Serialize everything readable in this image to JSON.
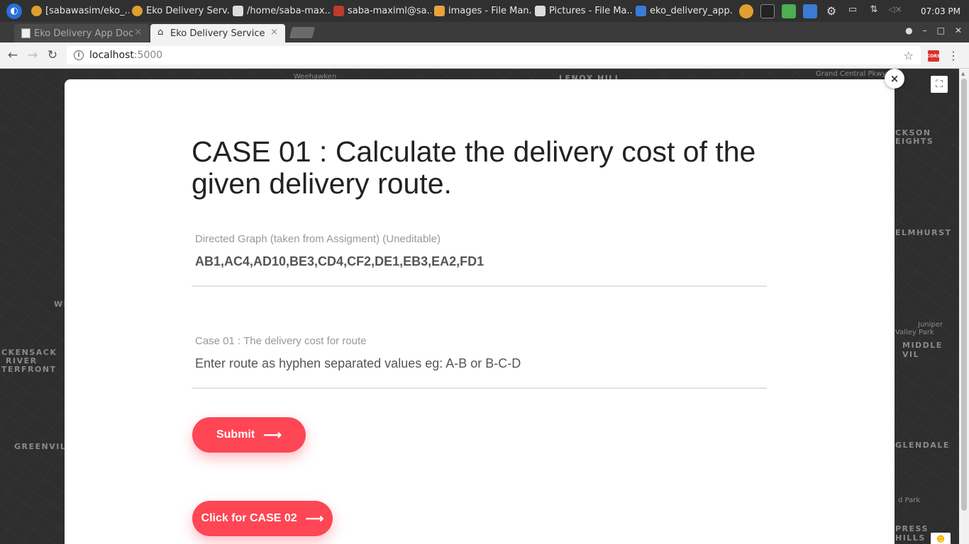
{
  "taskbar": {
    "items": [
      {
        "label": "[sabawasim/eko_...",
        "icon": "chrome-icon",
        "color": "#e0a030"
      },
      {
        "label": "Eko Delivery Serv...",
        "icon": "chrome-icon",
        "color": "#e0a030"
      },
      {
        "label": "/home/saba-max...",
        "icon": "text-editor-icon",
        "color": "#dddddd"
      },
      {
        "label": "saba-maximl@sa...",
        "icon": "terminal-icon",
        "color": "#c0392b"
      },
      {
        "label": "images - File Man...",
        "icon": "folder-icon",
        "color": "#e8a33b"
      },
      {
        "label": "Pictures - File Ma...",
        "icon": "folder-icon",
        "color": "#dddddd"
      },
      {
        "label": "eko_delivery_app...",
        "icon": "vscode-icon",
        "color": "#3a7bd5"
      }
    ],
    "clock": "07:03 PM"
  },
  "tabs": [
    {
      "label": "Eko Delivery App Doc",
      "close": "×"
    },
    {
      "label": "Eko Delivery Service",
      "close": "×"
    }
  ],
  "address": {
    "host": "localhost",
    "port": ":5000"
  },
  "map": {
    "labels": [
      "Weehawken",
      "LENOX HILL",
      "Grand Central Pkwy",
      "CKSON",
      "EIGHTS",
      "ELMHURST",
      "Juniper",
      "Valley Park",
      "MIDDLE VIL",
      "CKENSACK",
      "RIVER",
      "TERFRONT",
      "GREENVIL",
      "GLENDALE",
      "d Park",
      "PRESS HILLS",
      "WE"
    ]
  },
  "modal": {
    "title": "CASE 01 : Calculate the delivery cost of the given delivery route.",
    "graph_label": "Directed Graph (taken from Assigment) (Uneditable)",
    "graph_value": "AB1,AC4,AD10,BE3,CD4,CF2,DE1,EB3,EA2,FD1",
    "route_label": "Case 01 : The delivery cost for route",
    "route_placeholder": "Enter route as hyphen separated values eg: A-B or B-C-D",
    "submit_label": "Submit",
    "case2_label": "Click for CASE 02",
    "close": "×"
  },
  "colors": {
    "accent": "#fe4655"
  }
}
